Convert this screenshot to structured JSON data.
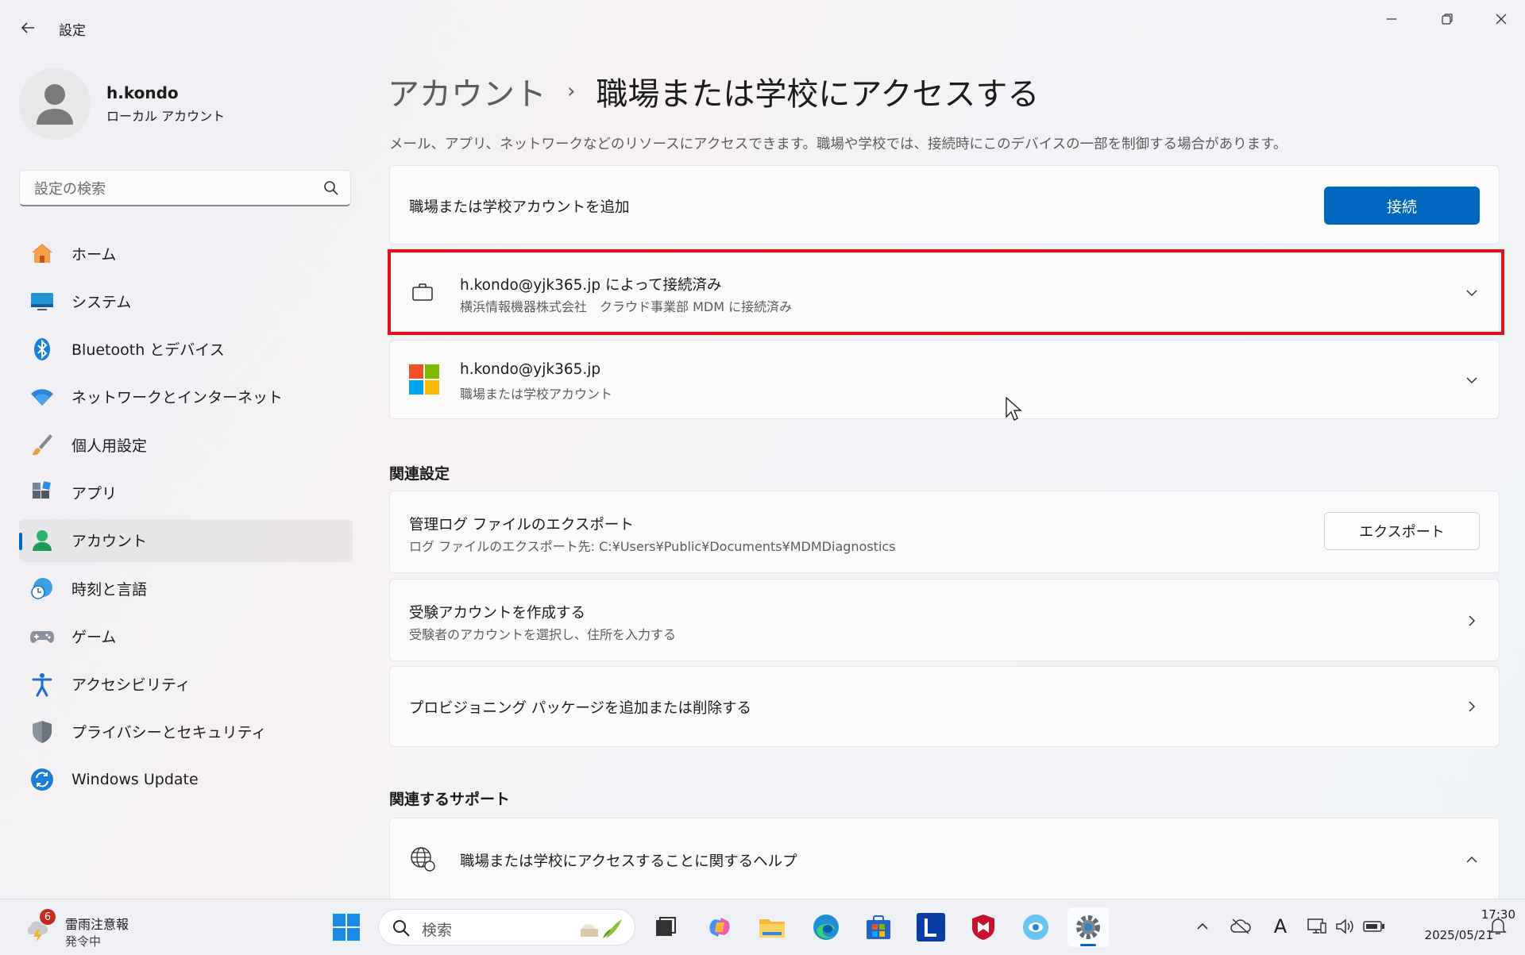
{
  "window": {
    "title": "設定"
  },
  "profile": {
    "name": "h.kondo",
    "account_type": "ローカル アカウント"
  },
  "search": {
    "placeholder": "設定の検索"
  },
  "nav": {
    "items": [
      {
        "label": "ホーム",
        "icon": "home-icon"
      },
      {
        "label": "システム",
        "icon": "monitor-icon"
      },
      {
        "label": "Bluetooth とデバイス",
        "icon": "bluetooth-icon"
      },
      {
        "label": "ネットワークとインターネット",
        "icon": "wifi-icon"
      },
      {
        "label": "個人用設定",
        "icon": "brush-icon"
      },
      {
        "label": "アプリ",
        "icon": "apps-icon"
      },
      {
        "label": "アカウント",
        "icon": "person-icon",
        "active": true
      },
      {
        "label": "時刻と言語",
        "icon": "globe-clock-icon"
      },
      {
        "label": "ゲーム",
        "icon": "gamepad-icon"
      },
      {
        "label": "アクセシビリティ",
        "icon": "accessibility-icon"
      },
      {
        "label": "プライバシーとセキュリティ",
        "icon": "shield-icon"
      },
      {
        "label": "Windows Update",
        "icon": "update-icon"
      }
    ]
  },
  "header": {
    "breadcrumb_parent": "アカウント",
    "breadcrumb_separator": "›",
    "breadcrumb_current": "職場または学校にアクセスする",
    "description": "メール、アプリ、ネットワークなどのリソースにアクセスできます。職場や学校では、接続時にこのデバイスの一部を制御する場合があります。"
  },
  "add_account": {
    "label": "職場または学校アカウントを追加",
    "button": "接続"
  },
  "accounts": [
    {
      "title": "h.kondo@yjk365.jp によって接続済み",
      "subtitle": "横浜情報機器株式会社　クラウド事業部 MDM に接続済み",
      "icon": "briefcase-icon"
    },
    {
      "title": "h.kondo@yjk365.jp",
      "subtitle": "職場または学校アカウント",
      "icon": "microsoft-logo-icon"
    }
  ],
  "related_settings": {
    "heading": "関連設定",
    "export": {
      "title": "管理ログ ファイルのエクスポート",
      "subtitle": "ログ ファイルのエクスポート先: C:¥Users¥Public¥Documents¥MDMDiagnostics",
      "button": "エクスポート"
    },
    "exam": {
      "title": "受験アカウントを作成する",
      "subtitle": "受験者のアカウントを選択し、住所を入力する"
    },
    "provisioning": {
      "title": "プロビジョニング パッケージを追加または削除する"
    }
  },
  "related_support": {
    "heading": "関連するサポート",
    "help": {
      "title": "職場または学校にアクセスすることに関するヘルプ"
    }
  },
  "taskbar": {
    "weather_title": "雷雨注意報",
    "weather_sub": "発令中",
    "weather_badge": "6",
    "search_label": "検索",
    "ime_indicator": "A",
    "time": "17:30",
    "date": "2025/05/21"
  },
  "colors": {
    "accent": "#0067c0",
    "highlight_box": "#e0141e"
  }
}
